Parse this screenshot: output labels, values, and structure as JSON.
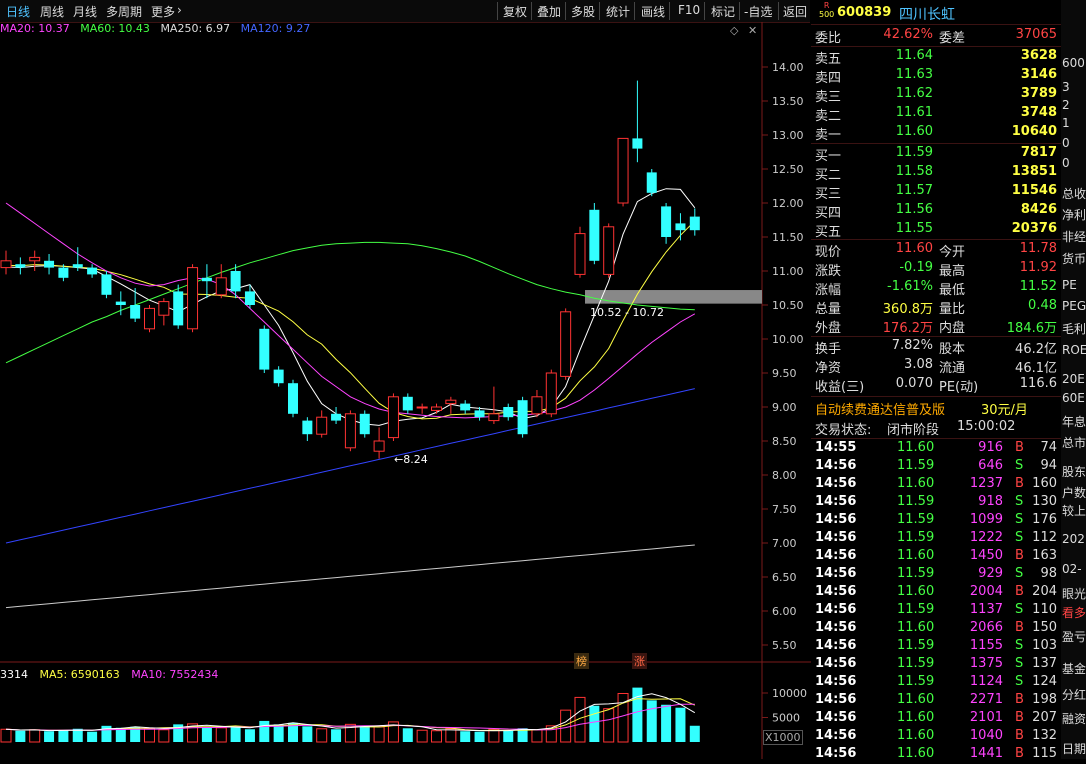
{
  "toolbar": {
    "tabs": [
      "日线",
      "周线",
      "月线",
      "多周期",
      "更多"
    ],
    "tools": [
      "复权",
      "叠加",
      "多股",
      "统计",
      "画线",
      "F10",
      "标记",
      "-自选",
      "返回"
    ]
  },
  "ma_legend": [
    {
      "text": "MA20: 10.37",
      "color": "#ff44ff"
    },
    {
      "text": "MA60: 10.43",
      "color": "#44ff44"
    },
    {
      "text": "MA250: 6.97",
      "color": "#dddddd"
    },
    {
      "text": "MA120: 9.27",
      "color": "#4466ff"
    }
  ],
  "vol_legend": [
    {
      "text": "3314",
      "color": "#ffffff"
    },
    {
      "text": "MA5: 6590163",
      "color": "#ffff44"
    },
    {
      "text": "MA10: 7552434",
      "color": "#ff44ff"
    }
  ],
  "price_axis": [
    "14.00",
    "13.50",
    "13.00",
    "12.50",
    "12.00",
    "11.50",
    "11.00",
    "10.50",
    "10.00",
    "9.50",
    "9.00",
    "8.50",
    "8.00",
    "7.50",
    "7.00",
    "6.50",
    "6.00",
    "5.50"
  ],
  "vol_axis": [
    "10000",
    "5000"
  ],
  "vol_unit": "X1000",
  "low_marker": "8.24",
  "band_label": "10.52 - 10.72",
  "event_tags": [
    "榜",
    "涨"
  ],
  "chart_data": {
    "type": "candlestick",
    "ylim": [
      5.0,
      14.5
    ],
    "candles": [
      {
        "o": 11.05,
        "c": 11.15,
        "h": 11.3,
        "l": 10.95
      },
      {
        "o": 11.1,
        "c": 11.05,
        "h": 11.2,
        "l": 10.95
      },
      {
        "o": 11.15,
        "c": 11.2,
        "h": 11.3,
        "l": 11.0
      },
      {
        "o": 11.15,
        "c": 11.05,
        "h": 11.25,
        "l": 10.95
      },
      {
        "o": 11.05,
        "c": 10.9,
        "h": 11.1,
        "l": 10.85
      },
      {
        "o": 11.1,
        "c": 11.05,
        "h": 11.35,
        "l": 11.0
      },
      {
        "o": 11.05,
        "c": 10.95,
        "h": 11.1,
        "l": 10.9
      },
      {
        "o": 10.95,
        "c": 10.65,
        "h": 11.0,
        "l": 10.6
      },
      {
        "o": 10.55,
        "c": 10.5,
        "h": 10.7,
        "l": 10.35
      },
      {
        "o": 10.5,
        "c": 10.3,
        "h": 10.75,
        "l": 10.25
      },
      {
        "o": 10.15,
        "c": 10.45,
        "h": 10.5,
        "l": 10.1
      },
      {
        "o": 10.35,
        "c": 10.55,
        "h": 10.6,
        "l": 10.2
      },
      {
        "o": 10.7,
        "c": 10.2,
        "h": 10.8,
        "l": 10.15
      },
      {
        "o": 10.15,
        "c": 11.05,
        "h": 11.1,
        "l": 10.1
      },
      {
        "o": 10.9,
        "c": 10.85,
        "h": 11.1,
        "l": 10.6
      },
      {
        "o": 10.65,
        "c": 10.9,
        "h": 11.1,
        "l": 10.6
      },
      {
        "o": 11.0,
        "c": 10.7,
        "h": 11.1,
        "l": 10.6
      },
      {
        "o": 10.7,
        "c": 10.5,
        "h": 10.8,
        "l": 10.45
      },
      {
        "o": 10.15,
        "c": 9.55,
        "h": 10.2,
        "l": 9.5
      },
      {
        "o": 9.55,
        "c": 9.35,
        "h": 9.6,
        "l": 9.3
      },
      {
        "o": 9.35,
        "c": 8.9,
        "h": 9.4,
        "l": 8.85
      },
      {
        "o": 8.8,
        "c": 8.6,
        "h": 8.85,
        "l": 8.5
      },
      {
        "o": 8.6,
        "c": 8.85,
        "h": 8.95,
        "l": 8.55
      },
      {
        "o": 8.9,
        "c": 8.8,
        "h": 9.0,
        "l": 8.75
      },
      {
        "o": 8.4,
        "c": 8.9,
        "h": 8.95,
        "l": 8.35
      },
      {
        "o": 8.9,
        "c": 8.6,
        "h": 8.95,
        "l": 8.55
      },
      {
        "o": 8.35,
        "c": 8.5,
        "h": 8.7,
        "l": 8.24
      },
      {
        "o": 8.55,
        "c": 9.15,
        "h": 9.2,
        "l": 8.5
      },
      {
        "o": 9.15,
        "c": 8.95,
        "h": 9.2,
        "l": 8.9
      },
      {
        "o": 9.0,
        "c": 9.0,
        "h": 9.05,
        "l": 8.9
      },
      {
        "o": 8.95,
        "c": 9.0,
        "h": 9.05,
        "l": 8.9
      },
      {
        "o": 9.05,
        "c": 9.1,
        "h": 9.15,
        "l": 8.9
      },
      {
        "o": 9.05,
        "c": 8.95,
        "h": 9.1,
        "l": 8.9
      },
      {
        "o": 8.95,
        "c": 8.85,
        "h": 9.0,
        "l": 8.8
      },
      {
        "o": 8.8,
        "c": 8.9,
        "h": 9.3,
        "l": 8.75
      },
      {
        "o": 9.0,
        "c": 8.85,
        "h": 9.05,
        "l": 8.8
      },
      {
        "o": 9.1,
        "c": 8.6,
        "h": 9.15,
        "l": 8.55
      },
      {
        "o": 8.9,
        "c": 9.15,
        "h": 9.25,
        "l": 8.85
      },
      {
        "o": 8.9,
        "c": 9.5,
        "h": 9.55,
        "l": 8.85
      },
      {
        "o": 9.45,
        "c": 10.4,
        "h": 10.45,
        "l": 9.4
      },
      {
        "o": 10.95,
        "c": 11.55,
        "h": 11.65,
        "l": 10.9
      },
      {
        "o": 11.9,
        "c": 11.15,
        "h": 12.0,
        "l": 11.1
      },
      {
        "o": 10.95,
        "c": 11.65,
        "h": 11.7,
        "l": 10.9
      },
      {
        "o": 12.0,
        "c": 12.95,
        "h": 12.95,
        "l": 11.95
      },
      {
        "o": 12.95,
        "c": 12.8,
        "h": 13.8,
        "l": 12.6
      },
      {
        "o": 12.45,
        "c": 12.15,
        "h": 12.5,
        "l": 12.1
      },
      {
        "o": 11.95,
        "c": 11.5,
        "h": 12.0,
        "l": 11.4
      },
      {
        "o": 11.7,
        "c": 11.6,
        "h": 11.85,
        "l": 11.45
      },
      {
        "o": 11.8,
        "c": 11.6,
        "h": 11.92,
        "l": 11.52
      }
    ],
    "volume": [
      2600,
      2300,
      2500,
      2200,
      2400,
      2700,
      2100,
      3300,
      2900,
      3100,
      2700,
      2500,
      3600,
      3700,
      3000,
      2900,
      3200,
      2600,
      4300,
      3600,
      3900,
      3200,
      2700,
      2600,
      3600,
      3300,
      3100,
      4100,
      2800,
      2400,
      2300,
      2700,
      2200,
      2100,
      2600,
      2300,
      2800,
      2500,
      3300,
      6500,
      9100,
      7400,
      6800,
      9900,
      11100,
      8500,
      7600,
      7000,
      3314
    ]
  },
  "quote": {
    "code": "600839",
    "name": "四川长虹",
    "badge_top": "R",
    "badge_bottom": "500",
    "webi_label": "委比",
    "webi_value": "42.62%",
    "weicha_label": "委差",
    "weicha_value": "37065",
    "sells": [
      {
        "label": "卖五",
        "price": "11.64",
        "vol": "3628"
      },
      {
        "label": "卖四",
        "price": "11.63",
        "vol": "3146"
      },
      {
        "label": "卖三",
        "price": "11.62",
        "vol": "3789"
      },
      {
        "label": "卖二",
        "price": "11.61",
        "vol": "3748"
      },
      {
        "label": "卖一",
        "price": "11.60",
        "vol": "10640"
      }
    ],
    "buys": [
      {
        "label": "买一",
        "price": "11.59",
        "vol": "7817"
      },
      {
        "label": "买二",
        "price": "11.58",
        "vol": "13851"
      },
      {
        "label": "买三",
        "price": "11.57",
        "vol": "11546"
      },
      {
        "label": "买四",
        "price": "11.56",
        "vol": "8426"
      },
      {
        "label": "买五",
        "price": "11.55",
        "vol": "20376"
      }
    ],
    "stats": [
      {
        "l1": "现价",
        "v1": "11.60",
        "c1": "#ff4444",
        "l2": "今开",
        "v2": "11.78",
        "c2": "#ff4444"
      },
      {
        "l1": "涨跌",
        "v1": "-0.19",
        "c1": "#44ff44",
        "l2": "最高",
        "v2": "11.92",
        "c2": "#ff4444"
      },
      {
        "l1": "涨幅",
        "v1": "-1.61%",
        "c1": "#44ff44",
        "l2": "最低",
        "v2": "11.52",
        "c2": "#44ff44"
      },
      {
        "l1": "总量",
        "v1": "360.8万",
        "c1": "#ffff44",
        "l2": "量比",
        "v2": "0.48",
        "c2": "#44ff44"
      },
      {
        "l1": "外盘",
        "v1": "176.2万",
        "c1": "#ff4444",
        "l2": "内盘",
        "v2": "184.6万",
        "c2": "#44ff44"
      }
    ],
    "stats2": [
      {
        "l1": "换手",
        "v1": "7.82%",
        "l2": "股本",
        "v2": "46.2亿"
      },
      {
        "l1": "净资",
        "v1": "3.08",
        "l2": "流通",
        "v2": "46.1亿"
      },
      {
        "l1": "收益(三)",
        "v1": "0.070",
        "l2": "PE(动)",
        "v2": "116.6"
      }
    ],
    "promo": "自动续费通达信普及版",
    "promo_price": "30元/月",
    "status_label": "交易状态:",
    "status_value": "闭市阶段",
    "status_time": "15:00:02",
    "ticks": [
      {
        "t": "14:55",
        "p": "11.60",
        "v": "916",
        "s": "B",
        "n": "74"
      },
      {
        "t": "14:56",
        "p": "11.59",
        "v": "646",
        "s": "S",
        "n": "94"
      },
      {
        "t": "14:56",
        "p": "11.60",
        "v": "1237",
        "s": "B",
        "n": "160"
      },
      {
        "t": "14:56",
        "p": "11.59",
        "v": "918",
        "s": "S",
        "n": "130"
      },
      {
        "t": "14:56",
        "p": "11.59",
        "v": "1099",
        "s": "S",
        "n": "176"
      },
      {
        "t": "14:56",
        "p": "11.59",
        "v": "1222",
        "s": "S",
        "n": "112"
      },
      {
        "t": "14:56",
        "p": "11.60",
        "v": "1450",
        "s": "B",
        "n": "163"
      },
      {
        "t": "14:56",
        "p": "11.59",
        "v": "929",
        "s": "S",
        "n": "98"
      },
      {
        "t": "14:56",
        "p": "11.60",
        "v": "2004",
        "s": "B",
        "n": "204"
      },
      {
        "t": "14:56",
        "p": "11.59",
        "v": "1137",
        "s": "S",
        "n": "110"
      },
      {
        "t": "14:56",
        "p": "11.60",
        "v": "2066",
        "s": "B",
        "n": "150"
      },
      {
        "t": "14:56",
        "p": "11.59",
        "v": "1155",
        "s": "S",
        "n": "103"
      },
      {
        "t": "14:56",
        "p": "11.59",
        "v": "1375",
        "s": "S",
        "n": "137"
      },
      {
        "t": "14:56",
        "p": "11.59",
        "v": "1124",
        "s": "S",
        "n": "124"
      },
      {
        "t": "14:56",
        "p": "11.60",
        "v": "2271",
        "s": "B",
        "n": "198"
      },
      {
        "t": "14:56",
        "p": "11.60",
        "v": "2101",
        "s": "B",
        "n": "207"
      },
      {
        "t": "14:56",
        "p": "11.60",
        "v": "1040",
        "s": "B",
        "n": "132"
      },
      {
        "t": "14:56",
        "p": "11.60",
        "v": "1441",
        "s": "B",
        "n": "115"
      }
    ]
  },
  "edge_panel": [
    "600",
    "3",
    "2",
    "1",
    "0",
    "0",
    "总收",
    "净利",
    "非经",
    "货币",
    "PE",
    "PEG",
    "毛利",
    "ROE",
    "20E",
    "60E",
    "年息",
    "总市",
    "股东",
    "户数",
    "较上",
    "202",
    "02-",
    "眼光",
    "看多",
    "盈亏",
    "基金",
    "分红",
    "融资",
    "日期"
  ]
}
